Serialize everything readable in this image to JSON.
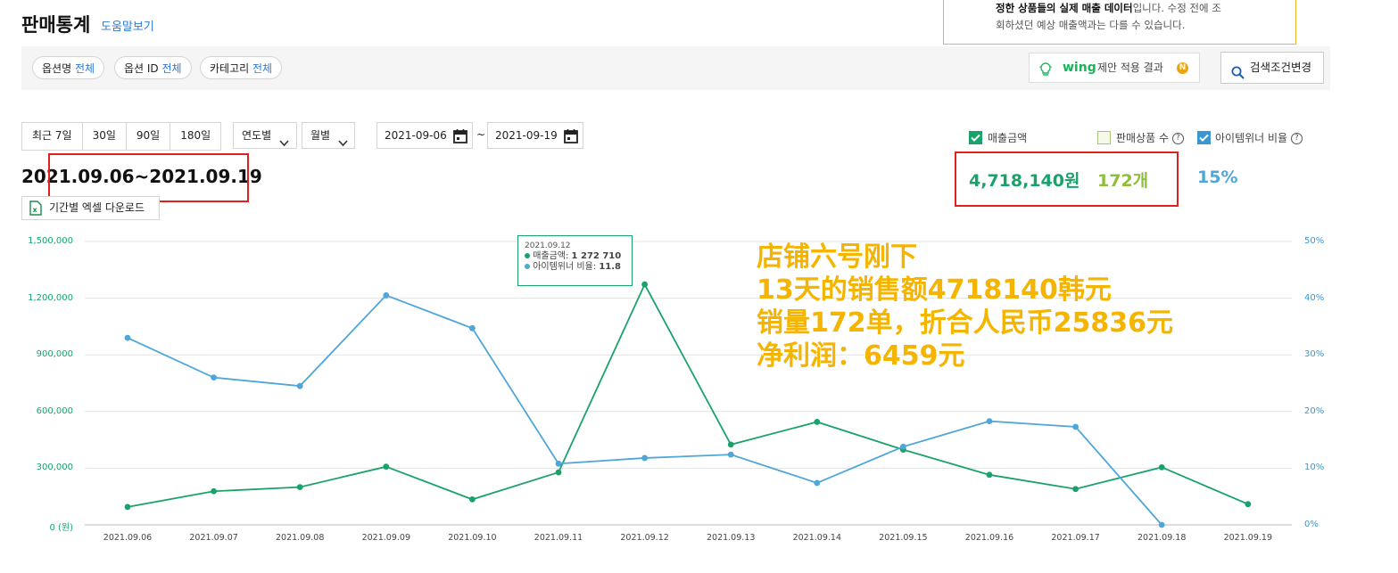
{
  "header": {
    "title": "판매통계",
    "help_link": "도움말보기"
  },
  "notice": {
    "bold_text": "정한 상품들의 실제 매출 데이터",
    "line1_rest": "입니다. 수정 전에 조",
    "line2": "회하셨던 예상 매출액과는 다를 수 있습니다."
  },
  "filters": {
    "option_name_label": "옵션명",
    "option_name_value": "전체",
    "option_id_label": "옵션 ID",
    "option_id_value": "전체",
    "category_label": "카테고리",
    "category_value": "전체",
    "wing_logo": "wing",
    "wing_text": "제안 적용 결과",
    "wing_badge": "N",
    "search_change": "검색조건변경"
  },
  "period_buttons": [
    "최근 7일",
    "30일",
    "90일",
    "180일"
  ],
  "year_select": "연도별",
  "month_select": "월별",
  "date_start": "2021-09-06",
  "date_sep": "~",
  "date_end": "2021-09-19",
  "range_label": "2021.09.06~2021.09.19",
  "excel_download": "기간별 엑셀 다운로드",
  "toggles": {
    "sales_amount": "매출금액",
    "sold_count": "판매상품 수",
    "item_winner": "아이템위너 비율"
  },
  "kpis": {
    "sales_amount": "4,718,140원",
    "sold_count": "172개",
    "item_winner": "15%"
  },
  "colors": {
    "sales": "#1aa26b",
    "winner": "#4ea6d9",
    "sold": "#8fbf3a",
    "highlight": "#e0201b",
    "annotation": "#f5b400"
  },
  "chart_tooltip": {
    "date": "2021.09.12",
    "sales_label": "매출금액:",
    "sales_value": "1 272 710",
    "winner_label": "아이템위너 비율:",
    "winner_value": "11.8"
  },
  "annotation": {
    "lines": [
      "店铺六号刚下",
      "13天的销售额4718140韩元",
      "销量172单，折合人民币25836元",
      "净利润：6459元"
    ]
  },
  "chart_data": {
    "type": "line",
    "categories": [
      "2021.09.06",
      "2021.09.07",
      "2021.09.08",
      "2021.09.09",
      "2021.09.10",
      "2021.09.11",
      "2021.09.12",
      "2021.09.13",
      "2021.09.14",
      "2021.09.15",
      "2021.09.16",
      "2021.09.17",
      "2021.09.18",
      "2021.09.19"
    ],
    "y_left": {
      "ticks": [
        "0 (원)",
        "300,000",
        "600,000",
        "900,000",
        "1,200,000",
        "1,500,000"
      ],
      "range": [
        0,
        1500000
      ]
    },
    "y_right": {
      "ticks": [
        "0%",
        "10%",
        "20%",
        "30%",
        "40%",
        "50%"
      ],
      "range": [
        0,
        50
      ]
    },
    "series": [
      {
        "axis": "left",
        "values": [
          95000,
          178000,
          200000,
          308000,
          135000,
          278000,
          1272710,
          425000,
          545000,
          398000,
          265000,
          190000,
          305000,
          110000
        ]
      },
      {
        "axis": "right",
        "values": [
          33,
          26,
          24.5,
          40.5,
          34.7,
          10.8,
          11.8,
          12.4,
          7.4,
          13.8,
          18.3,
          17.3,
          0,
          null
        ]
      }
    ],
    "grid": true
  }
}
